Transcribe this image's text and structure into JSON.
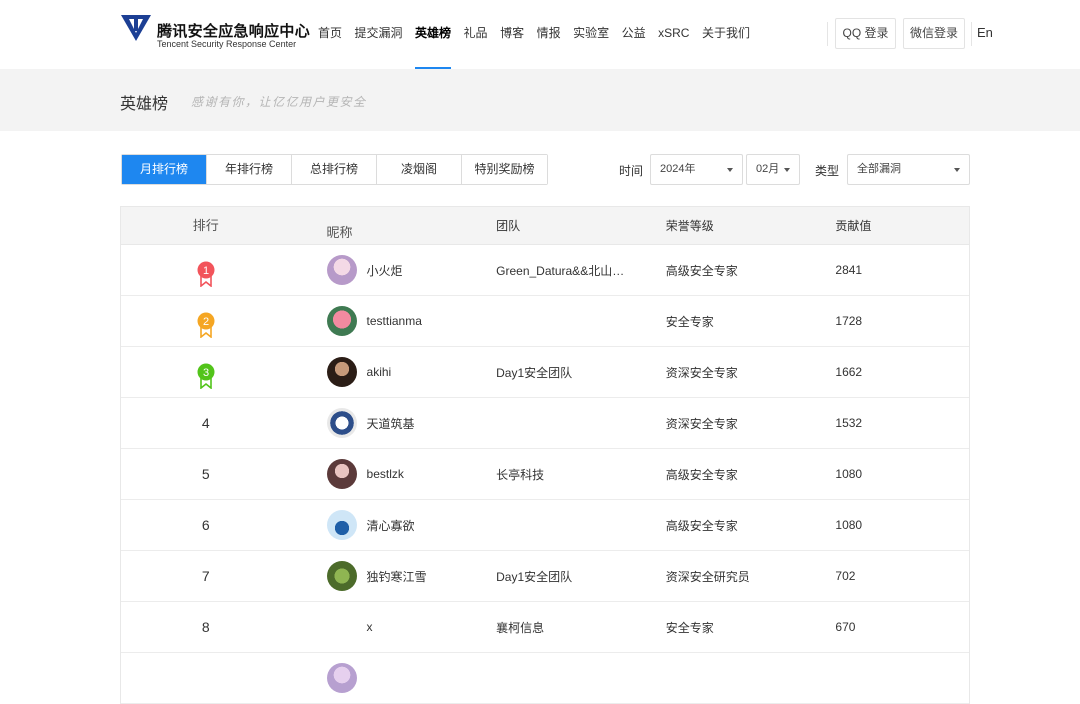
{
  "header": {
    "logo_cn": "腾讯安全应急响应中心",
    "logo_en": "Tencent Security Response Center",
    "nav": [
      {
        "label": "首页",
        "active": false
      },
      {
        "label": "提交漏洞",
        "active": false
      },
      {
        "label": "英雄榜",
        "active": true
      },
      {
        "label": "礼品",
        "active": false
      },
      {
        "label": "博客",
        "active": false
      },
      {
        "label": "情报",
        "active": false
      },
      {
        "label": "实验室",
        "active": false
      },
      {
        "label": "公益",
        "active": false
      },
      {
        "label": "xSRC",
        "active": false
      },
      {
        "label": "关于我们",
        "active": false
      }
    ],
    "qq_login": "QQ 登录",
    "wechat_login": "微信登录",
    "lang": "En"
  },
  "banner": {
    "title": "英雄榜",
    "subtitle": "感谢有你，让亿亿用户更安全"
  },
  "tabs": [
    {
      "label": "月排行榜",
      "active": true
    },
    {
      "label": "年排行榜",
      "active": false
    },
    {
      "label": "总排行榜",
      "active": false
    },
    {
      "label": "凌烟阁",
      "active": false
    },
    {
      "label": "特别奖励榜",
      "active": false
    }
  ],
  "filters": {
    "time_label": "时间",
    "year": "2024年",
    "month": "02月",
    "type_label": "类型",
    "type": "全部漏洞"
  },
  "table": {
    "headers": {
      "rank": "排行",
      "nick": "昵称",
      "team": "团队",
      "level": "荣誉等级",
      "score": "贡献值"
    },
    "rows": [
      {
        "rank": "1",
        "nick": "小火炬",
        "team": "Green_Datura&&北山…",
        "level": "高级安全专家",
        "score": "2841",
        "medal_color": "#f2545b"
      },
      {
        "rank": "2",
        "nick": "testtianma",
        "team": "",
        "level": "安全专家",
        "score": "1728",
        "medal_color": "#f5a623"
      },
      {
        "rank": "3",
        "nick": "akihi",
        "team": "Day1安全团队",
        "level": "资深安全专家",
        "score": "1662",
        "medal_color": "#52c41a"
      },
      {
        "rank": "4",
        "nick": "天道筑基",
        "team": "",
        "level": "资深安全专家",
        "score": "1532"
      },
      {
        "rank": "5",
        "nick": "bestlzk",
        "team": "长亭科技",
        "level": "高级安全专家",
        "score": "1080"
      },
      {
        "rank": "6",
        "nick": "清心寡欲",
        "team": "",
        "level": "高级安全专家",
        "score": "1080"
      },
      {
        "rank": "7",
        "nick": "独钓寒江雪",
        "team": "Day1安全团队",
        "level": "资深安全研究员",
        "score": "702"
      },
      {
        "rank": "8",
        "nick": "x",
        "team": "襄柯信息",
        "level": "安全专家",
        "score": "670"
      }
    ]
  },
  "colors": {
    "accent": "#1e87f0"
  }
}
